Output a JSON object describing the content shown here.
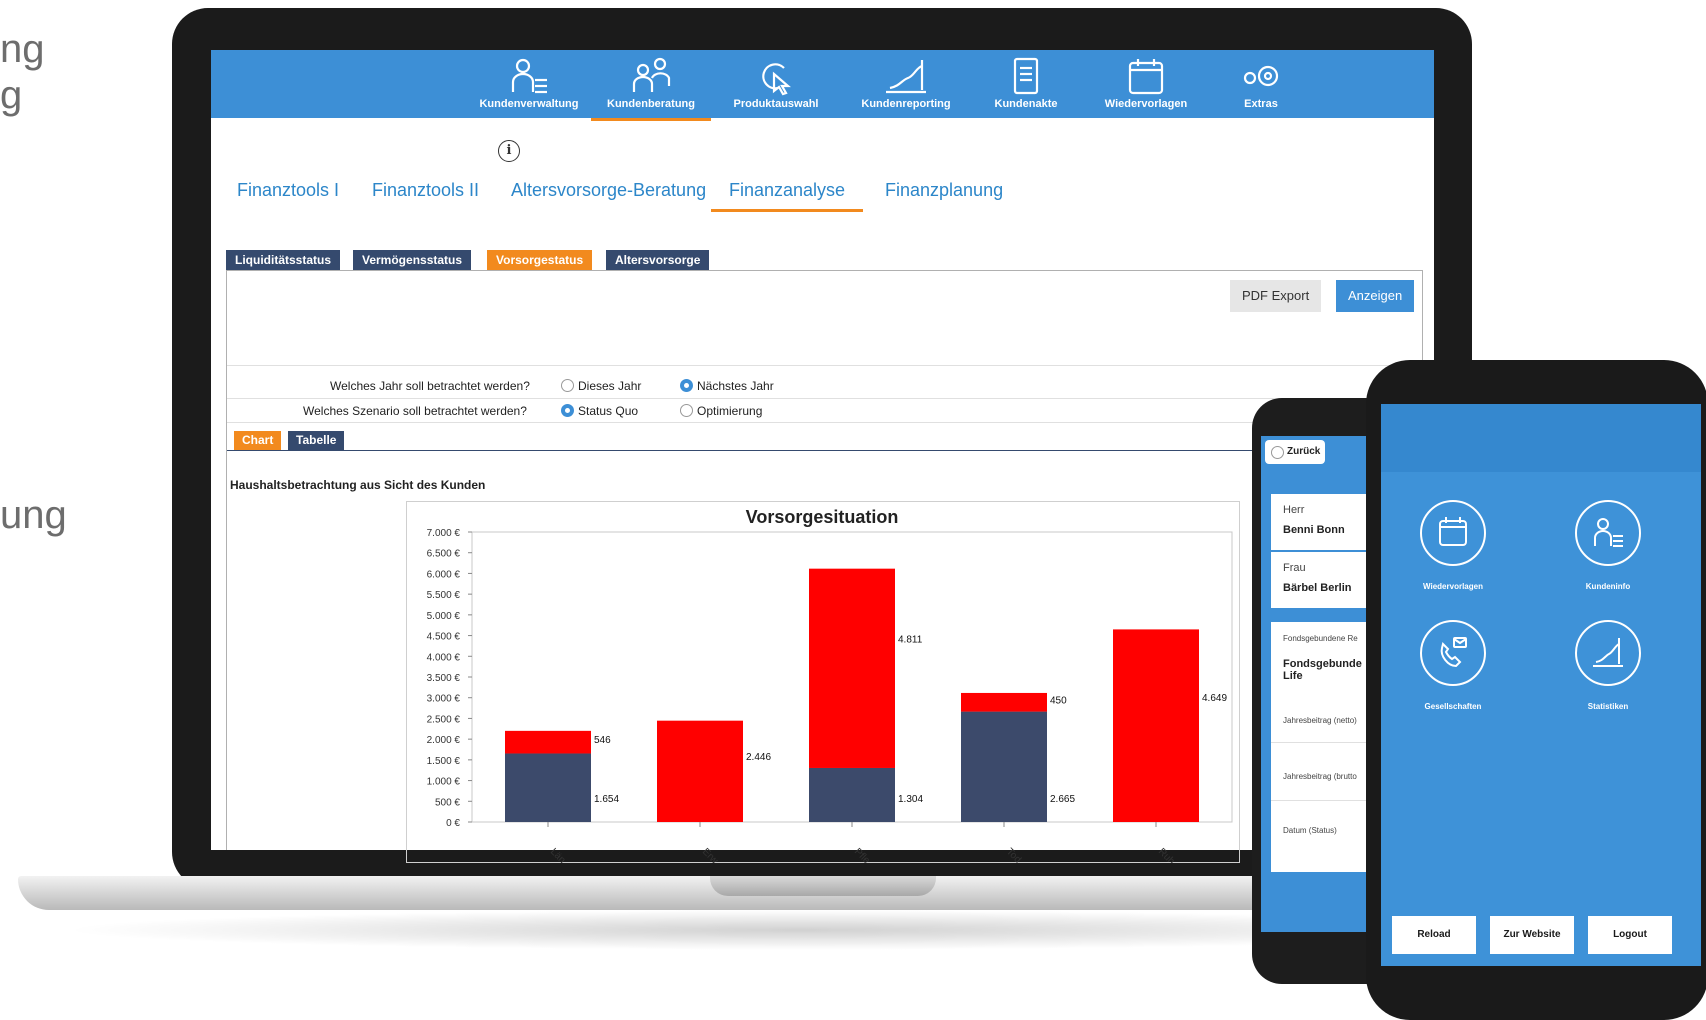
{
  "side_texts": [
    "ng",
    "g",
    "ung"
  ],
  "nav": {
    "items": [
      {
        "label": "Kundenverwaltung",
        "icon": "person-list-icon"
      },
      {
        "label": "Kundenberatung",
        "icon": "people-icon"
      },
      {
        "label": "Produktauswahl",
        "icon": "cursor-click-icon"
      },
      {
        "label": "Kundenreporting",
        "icon": "chart-growth-icon"
      },
      {
        "label": "Kundenakte",
        "icon": "document-icon"
      },
      {
        "label": "Wiedervorlagen",
        "icon": "calendar-icon"
      },
      {
        "label": "Extras",
        "icon": "gears-icon"
      }
    ],
    "active_index": 1
  },
  "tabs": [
    "Finanztools I",
    "Finanztools II",
    "Altersvorsorge-Beratung",
    "Finanzanalyse",
    "Finanzplanung"
  ],
  "active_tab_index": 3,
  "subtabs": [
    "Liquiditätsstatus",
    "Vermögensstatus",
    "Vorsorgestatus",
    "Altersvorsorge"
  ],
  "active_subtab_index": 2,
  "buttons": {
    "pdf": "PDF Export",
    "show": "Anzeigen"
  },
  "question_year": {
    "label": "Welches Jahr soll betrachtet werden?",
    "options": [
      "Dieses Jahr",
      "Nächstes Jahr"
    ],
    "selected": 1
  },
  "question_scenario": {
    "label": "Welches Szenario soll betrachtet werden?",
    "options": [
      "Status Quo",
      "Optimierung"
    ],
    "selected": 0
  },
  "view_tabs": {
    "chart": "Chart",
    "table": "Tabelle"
  },
  "section_title": "Haushaltsbetrachtung aus Sicht des Kunden",
  "colors": {
    "accent": "#3d8fd6",
    "orange": "#f28a1e",
    "navy": "#354a6e",
    "red": "#ff0000",
    "slate": "#3c4a6b"
  },
  "chart_data": {
    "type": "bar",
    "title": "Vorsorgesituation",
    "categories": [
      "Län...",
      "Erw...",
      "Pfle...",
      "Tod...",
      "Ruh..."
    ],
    "series": [
      {
        "values": [
          1654,
          0,
          1304,
          2665,
          0
        ],
        "value_labels": [
          "1.654",
          "",
          "1.304",
          "2.665",
          ""
        ],
        "color": "#3c4a6b"
      },
      {
        "values": [
          546,
          2446,
          4811,
          450,
          4649
        ],
        "value_labels": [
          "546",
          "2.446",
          "4.811",
          "450",
          "4.649"
        ],
        "color": "#ff0000"
      }
    ],
    "stacked": true,
    "ylim": [
      0,
      7000
    ],
    "y_ticks": [
      "0 €",
      "500 €",
      "1.000 €",
      "1.500 €",
      "2.000 €",
      "2.500 €",
      "3.000 €",
      "3.500 €",
      "4.000 €",
      "4.500 €",
      "5.000 €",
      "5.500 €",
      "6.000 €",
      "6.500 €",
      "7.000 €"
    ],
    "grid": false
  },
  "phone_back": {
    "back_label": "Zurück",
    "contacts": [
      {
        "salutation": "Herr",
        "name": "Benni Bonn"
      },
      {
        "salutation": "Frau",
        "name": "Bärbel Berlin"
      }
    ],
    "detail_header": "Fondsgebundene Re",
    "detail_title": "Fondsgebunde Life",
    "fields": [
      "Jahresbeitrag (netto)",
      "Jahresbeitrag (brutto",
      "Datum (Status)"
    ]
  },
  "phone_front": {
    "tiles": [
      {
        "label": "Wiedervorlagen",
        "icon": "calendar-icon"
      },
      {
        "label": "Kundeninfo",
        "icon": "person-list-icon"
      },
      {
        "label": "Gesellschaften",
        "icon": "phone-handshake-icon"
      },
      {
        "label": "Statistiken",
        "icon": "chart-growth-icon"
      }
    ],
    "buttons": [
      "Reload",
      "Zur Website",
      "Logout"
    ]
  }
}
